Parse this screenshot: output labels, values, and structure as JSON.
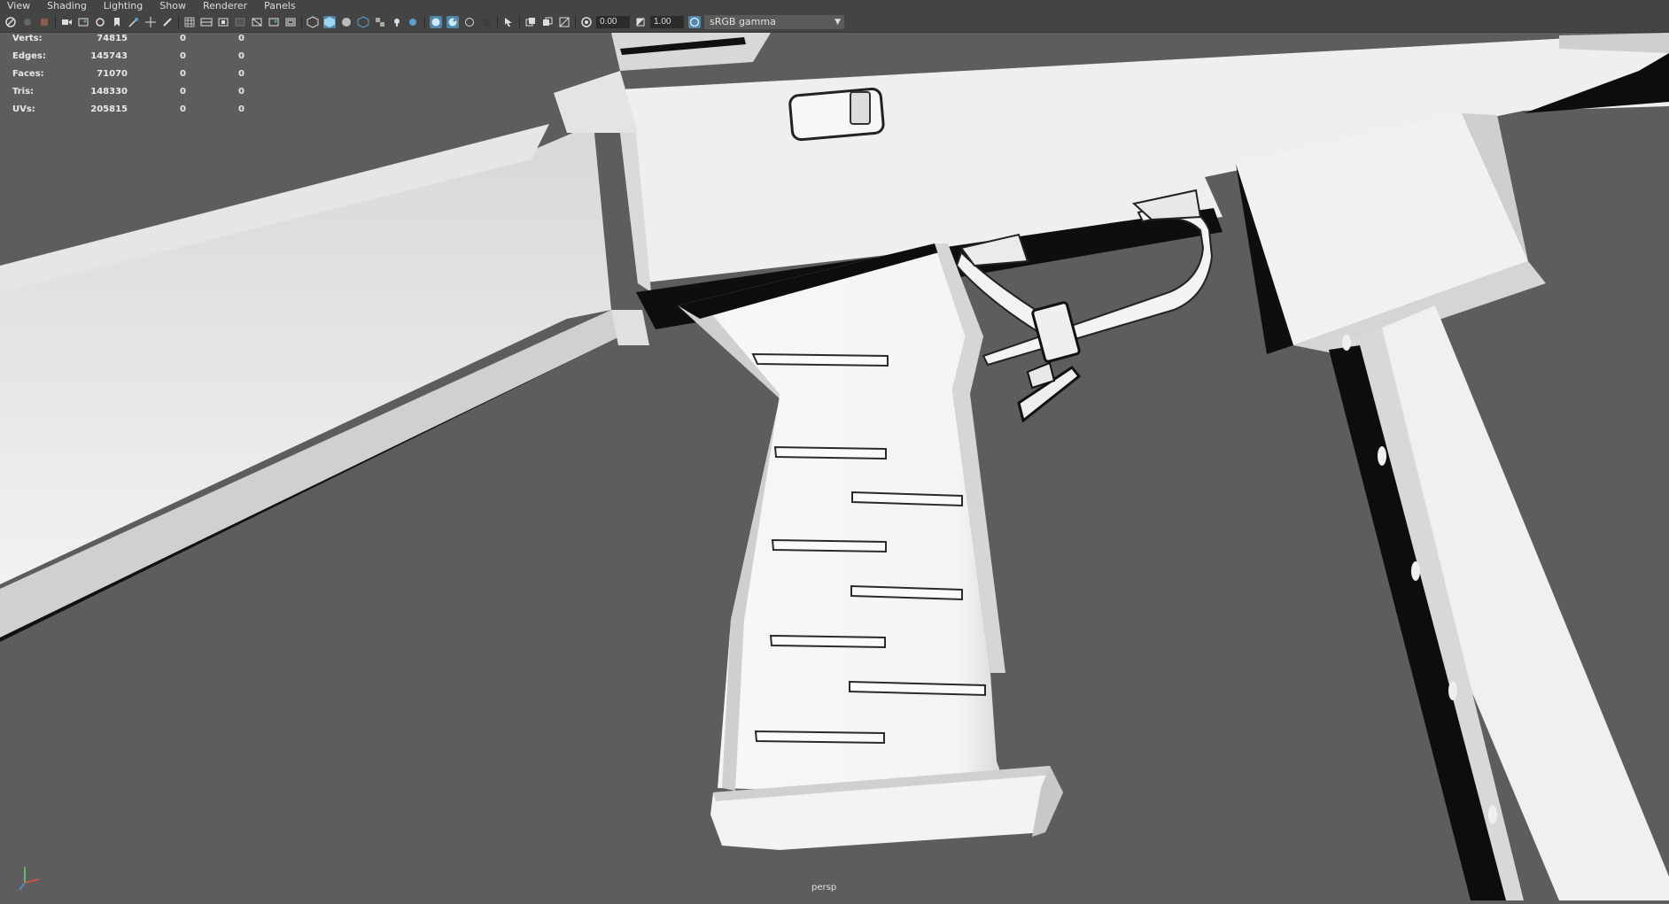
{
  "menu": {
    "items": [
      "View",
      "Shading",
      "Lighting",
      "Show",
      "Renderer",
      "Panels"
    ]
  },
  "toolbar": {
    "exposure_value": "0.00",
    "gamma_value": "1.00",
    "color_space": "sRGB gamma",
    "icons": [
      "select-camera-icon",
      "camera-attributes-icon",
      "bookmark-icon",
      "image-plane-icon",
      "2d-pan-zoom-icon",
      "grease-pencil-icon",
      "grid-icon",
      "film-gate-icon",
      "resolution-gate-icon",
      "gate-mask-icon",
      "field-chart-icon",
      "safe-action-icon",
      "wireframe-icon",
      "smooth-shade-icon",
      "default-material-icon",
      "textured-icon",
      "lights-icon",
      "shadows-icon",
      "xray-icon",
      "isolate-select-icon"
    ]
  },
  "hud": {
    "rows": [
      {
        "label": "Verts:",
        "value": "74815",
        "sel": "0",
        "comp": "0"
      },
      {
        "label": "Edges:",
        "value": "145743",
        "sel": "0",
        "comp": "0"
      },
      {
        "label": "Faces:",
        "value": "71070",
        "sel": "0",
        "comp": "0"
      },
      {
        "label": "Tris:",
        "value": "148330",
        "sel": "0",
        "comp": "0"
      },
      {
        "label": "UVs:",
        "value": "205815",
        "sel": "0",
        "comp": "0"
      }
    ]
  },
  "viewport": {
    "camera": "persp",
    "background_color": "#5d5d5d",
    "model_color": "#efefef"
  },
  "colors": {
    "ui_bg": "#444444",
    "active_icon": "#5285a6"
  }
}
